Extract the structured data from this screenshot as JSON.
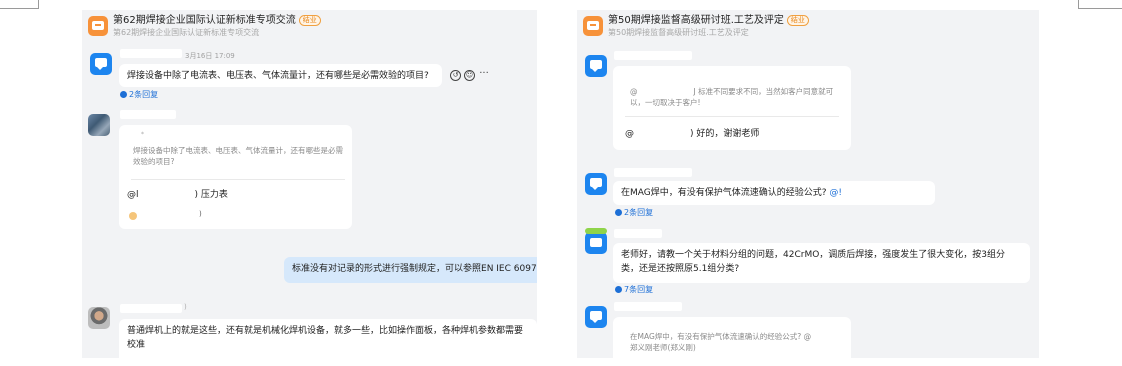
{
  "left_chat": {
    "group_title": "第62期焊接企业国际认证新标准专项交流",
    "group_badge": "结业",
    "group_subtitle": "第62期焊接企业国际认证新标准专项交流",
    "messages": [
      {
        "time": "3月16日 17:09",
        "text": "焊接设备中除了电流表、电压表、气体流量计，还有哪些是必需效验的项目?",
        "actions": [
          "reply-icon",
          "emoji-icon",
          "more-icon"
        ],
        "action_glyphs": [
          "↺",
          "☺",
          "···"
        ],
        "replies": "2条回复"
      },
      {
        "quote_mark": "*",
        "quote": "焊接设备中除了电流表、电压表、气体流量计，还有哪些是必需效验的项目?",
        "reply_prefix": "@",
        "reply_mask_tail": "l",
        "reply_suffix": ") 压力表",
        "reaction_tail": ")"
      },
      {
        "text": "标准没有对记录的形式进行强制规定，可以参照EN IEC 6097",
        "from_self": true
      },
      {
        "name_tail": ")",
        "text": "普通焊机上的就是这些，还有就是机械化焊机设备，就多一些，比如操作面板，各种焊机参数都需要校准"
      }
    ]
  },
  "right_chat": {
    "group_title": "第50期焊接监督高级研讨班.工艺及评定",
    "group_badge": "结业",
    "group_subtitle": "第50期焊接监督高级研讨班.工艺及评定",
    "messages": [
      {
        "quote_prefix": "@",
        "quote_mid": "J",
        "quote": "标准不同要求不同，当然如客户同意就可以，一切取决于客户!",
        "reply_prefix": "@",
        "reply_suffix": ") 好的，谢谢老师"
      },
      {
        "text": "在MAG焊中，有没有保护气体流速确认的经验公式?",
        "mention": "@!",
        "replies": "2条回复"
      },
      {
        "text": "老师好，请教一个关于材料分组的问题，42CrMO，调质后焊接，强度发生了很大变化，按3组分类，还是还按照原5.1组分类?",
        "replies": "7条回复"
      },
      {
        "quote": "在MAG焊中，有没有保护气体流速确认的经验公式? @",
        "quote_author": "郑义刚老师(郑义刚)"
      }
    ]
  },
  "colors": {
    "background": "#f2f3f5",
    "bubble": "#ffffff",
    "self_bubble": "#d6e8fb",
    "link": "#1d6fd6",
    "avatar_blue": "#1d85ef",
    "group_icon": "#f7923a",
    "badge": "#e8891f"
  }
}
